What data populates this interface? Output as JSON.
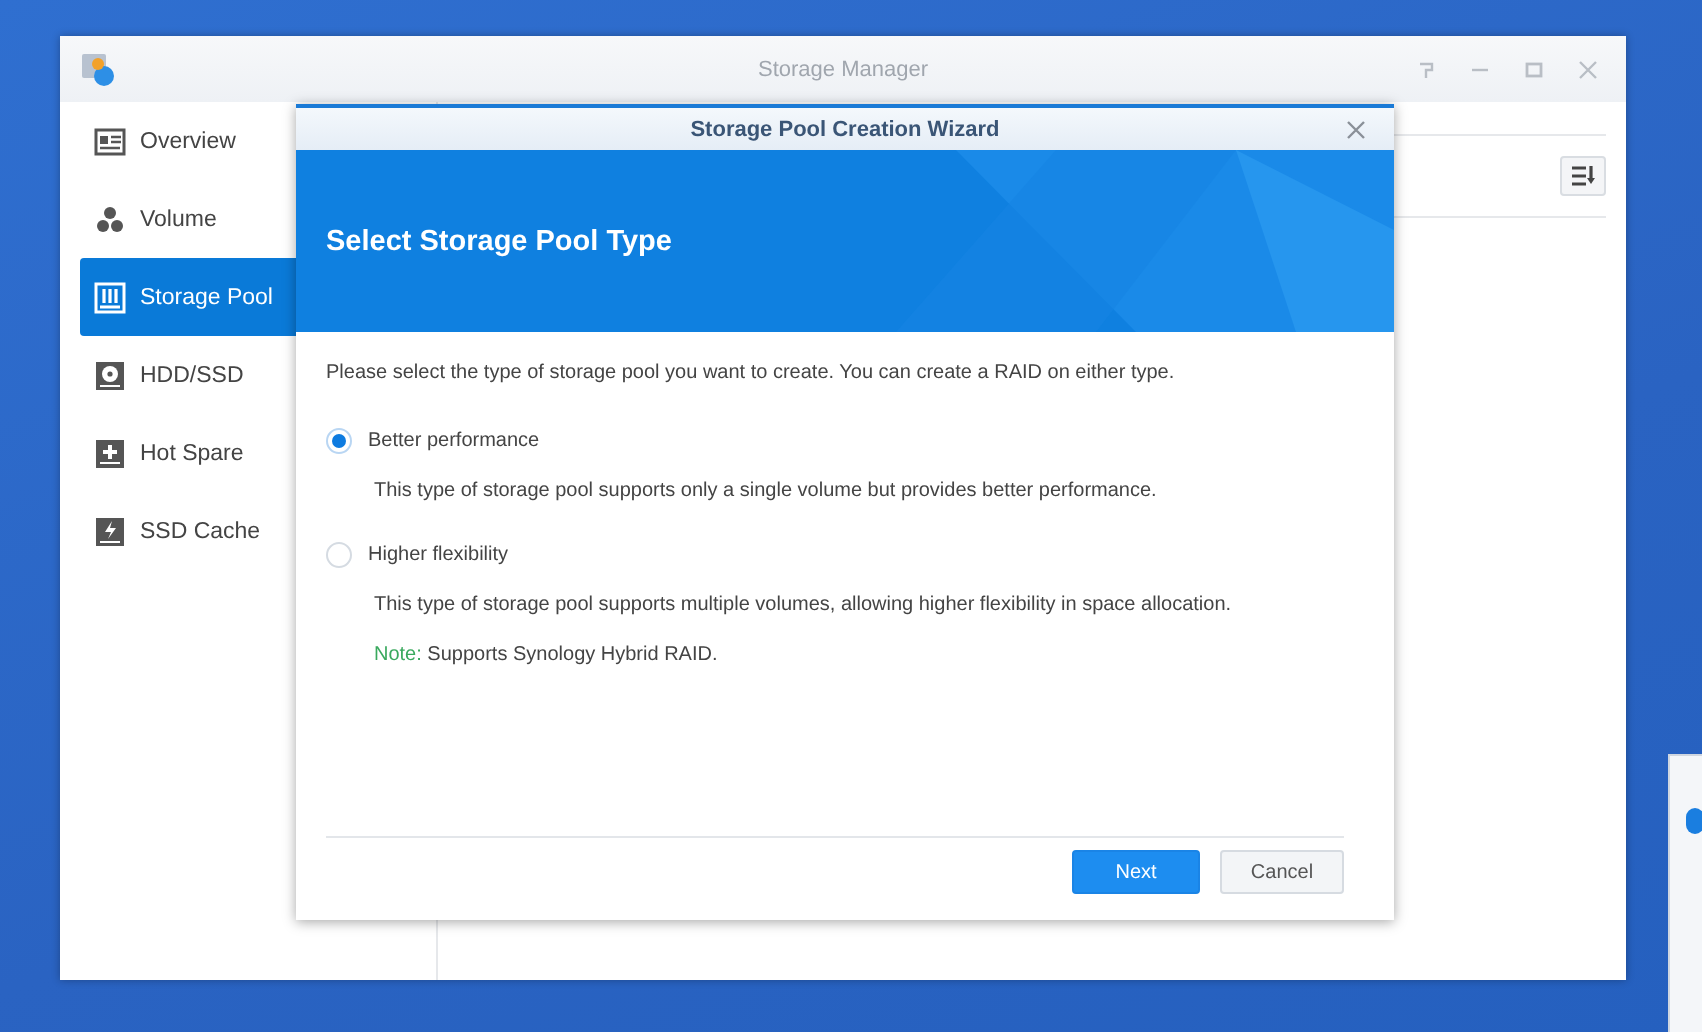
{
  "window": {
    "title": "Storage Manager"
  },
  "sidebar": {
    "items": [
      {
        "label": "Overview",
        "selected": false
      },
      {
        "label": "Volume",
        "selected": false
      },
      {
        "label": "Storage Pool",
        "selected": true
      },
      {
        "label": "HDD/SSD",
        "selected": false
      },
      {
        "label": "Hot Spare",
        "selected": false
      },
      {
        "label": "SSD Cache",
        "selected": false
      }
    ]
  },
  "wizard": {
    "title": "Storage Pool Creation Wizard",
    "heading": "Select Storage Pool Type",
    "intro": "Please select the type of storage pool you want to create. You can create a RAID on either type.",
    "options": [
      {
        "label": "Better performance",
        "description": "This type of storage pool supports only a single volume but provides better performance.",
        "selected": true
      },
      {
        "label": "Higher flexibility",
        "description": "This type of storage pool supports multiple volumes, allowing higher flexibility in space allocation.",
        "note_label": "Note:",
        "note_text": "Supports Synology Hybrid RAID.",
        "selected": false
      }
    ],
    "buttons": [
      {
        "label": "Next",
        "kind": "primary"
      },
      {
        "label": "Cancel",
        "kind": "secondary"
      }
    ]
  }
}
